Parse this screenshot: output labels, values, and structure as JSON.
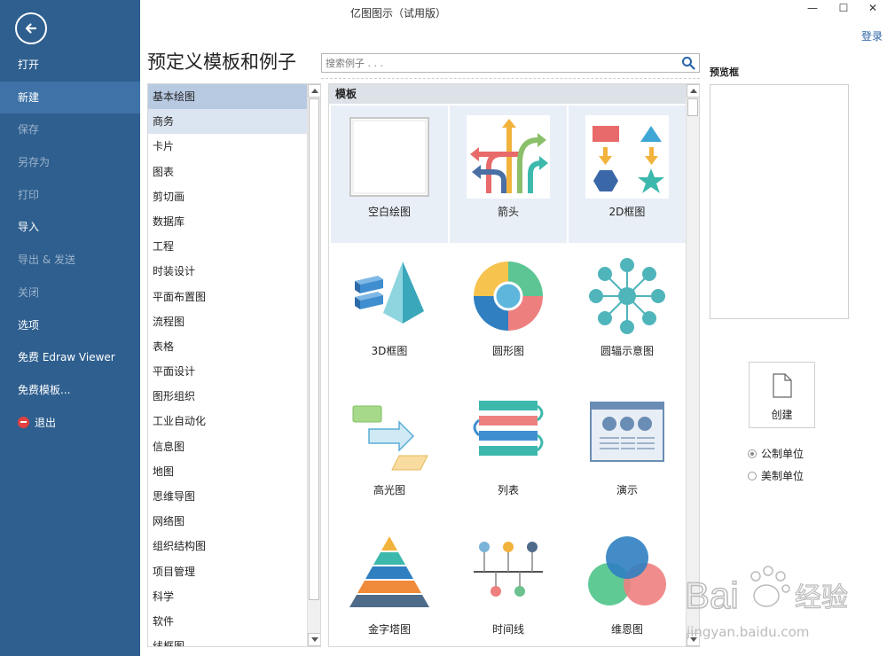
{
  "window": {
    "title": "亿图图示（试用版）",
    "minimize": "—",
    "maximize": "☐",
    "close": "✕",
    "login": "登录"
  },
  "sidebar": {
    "items": [
      {
        "label": "打开",
        "state": "normal"
      },
      {
        "label": "新建",
        "state": "active"
      },
      {
        "label": "保存",
        "state": "disabled"
      },
      {
        "label": "另存为",
        "state": "disabled"
      },
      {
        "label": "打印",
        "state": "disabled"
      },
      {
        "label": "导入",
        "state": "normal"
      },
      {
        "label": "导出 & 发送",
        "state": "disabled"
      },
      {
        "label": "关闭",
        "state": "disabled"
      },
      {
        "label": "选项",
        "state": "normal"
      },
      {
        "label": "免费 Edraw Viewer",
        "state": "normal"
      },
      {
        "label": "免费模板...",
        "state": "normal"
      },
      {
        "label": "退出",
        "state": "normal"
      }
    ]
  },
  "header": {
    "page_title": "预定义模板和例子",
    "search_placeholder": "搜索例子 . . ."
  },
  "categories": {
    "selected": "基本绘图",
    "hover": "商务",
    "items": [
      "基本绘图",
      "商务",
      "卡片",
      "图表",
      "剪切画",
      "数据库",
      "工程",
      "时装设计",
      "平面布置图",
      "流程图",
      "表格",
      "平面设计",
      "图形组织",
      "工业自动化",
      "信息图",
      "地图",
      "思维导图",
      "网络图",
      "组织结构图",
      "项目管理",
      "科学",
      "软件",
      "线框图"
    ]
  },
  "gallery": {
    "header": "模板",
    "tiles": [
      {
        "label": "空白绘图",
        "icon": "blank-page-icon"
      },
      {
        "label": "箭头",
        "icon": "arrows-icon"
      },
      {
        "label": "2D框图",
        "icon": "2d-blocks-icon"
      },
      {
        "label": "3D框图",
        "icon": "3d-blocks-icon"
      },
      {
        "label": "圆形图",
        "icon": "circular-diagram-icon"
      },
      {
        "label": "圆辐示意图",
        "icon": "spoke-diagram-icon"
      },
      {
        "label": "高光图",
        "icon": "highlight-diagram-icon"
      },
      {
        "label": "列表",
        "icon": "list-diagram-icon"
      },
      {
        "label": "演示",
        "icon": "presentation-icon"
      },
      {
        "label": "金字塔图",
        "icon": "pyramid-icon"
      },
      {
        "label": "时间线",
        "icon": "timeline-icon"
      },
      {
        "label": "维恩图",
        "icon": "venn-icon"
      }
    ]
  },
  "preview": {
    "title": "预览框",
    "create_label": "创建",
    "units": [
      {
        "label": "公制单位",
        "checked": true
      },
      {
        "label": "美制单位",
        "checked": false
      }
    ]
  },
  "watermark": {
    "brand": "Bai",
    "brand_suffix": "经验",
    "url": "jingyan.baidu.com"
  },
  "colors": {
    "sidebar": "#2e5f8f",
    "sidebar_active": "#3f73a8",
    "selected_category": "#b8c9e2",
    "link": "#2a62a8"
  }
}
